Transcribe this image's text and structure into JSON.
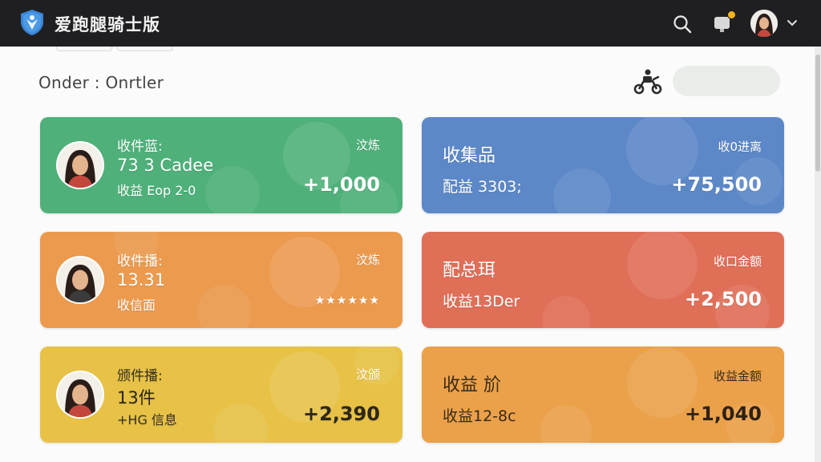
{
  "app": {
    "title": "爱跑腿骑士版"
  },
  "header": {
    "icons": [
      "shield-logo-icon",
      "search-icon",
      "notification-icon",
      "avatar",
      "chevron-down-icon"
    ]
  },
  "page": {
    "heading": "Onder : Onrtler",
    "scooter_icon": "scooter-icon"
  },
  "colors": {
    "green": "#4fb07a",
    "blue": "#5d88c7",
    "orange": "#eb9a4e",
    "red": "#e06f58",
    "yellow": "#e7c247",
    "amber": "#eba14a",
    "topbar": "#1f1f22",
    "notify_dot": "#f2b31b"
  },
  "cards": [
    {
      "title": "收件蓝:",
      "value": "73 3 Cadee",
      "sub": "收益 Eop 2-0",
      "tag": "汶炼",
      "amount": "+1,000"
    },
    {
      "title": "收集品",
      "sub": "配益 3303;",
      "tag": "收0进离",
      "amount": "+75,500"
    },
    {
      "title": "收件播:",
      "value": "13.31",
      "sub": "收信面",
      "tag": "汶炼",
      "stars": "★★★★★★"
    },
    {
      "title": "配总珥",
      "sub": "收益13Der",
      "tag": "收口金额",
      "amount": "+2,500"
    },
    {
      "title": "颁件播:",
      "value": "13件",
      "sub": "+HG 信息",
      "tag": "汶颁",
      "amount": "+2,390"
    },
    {
      "title": "收益 斺",
      "sub": "收益12-8c",
      "tag": "收益金额",
      "amount": "+1,040"
    }
  ]
}
